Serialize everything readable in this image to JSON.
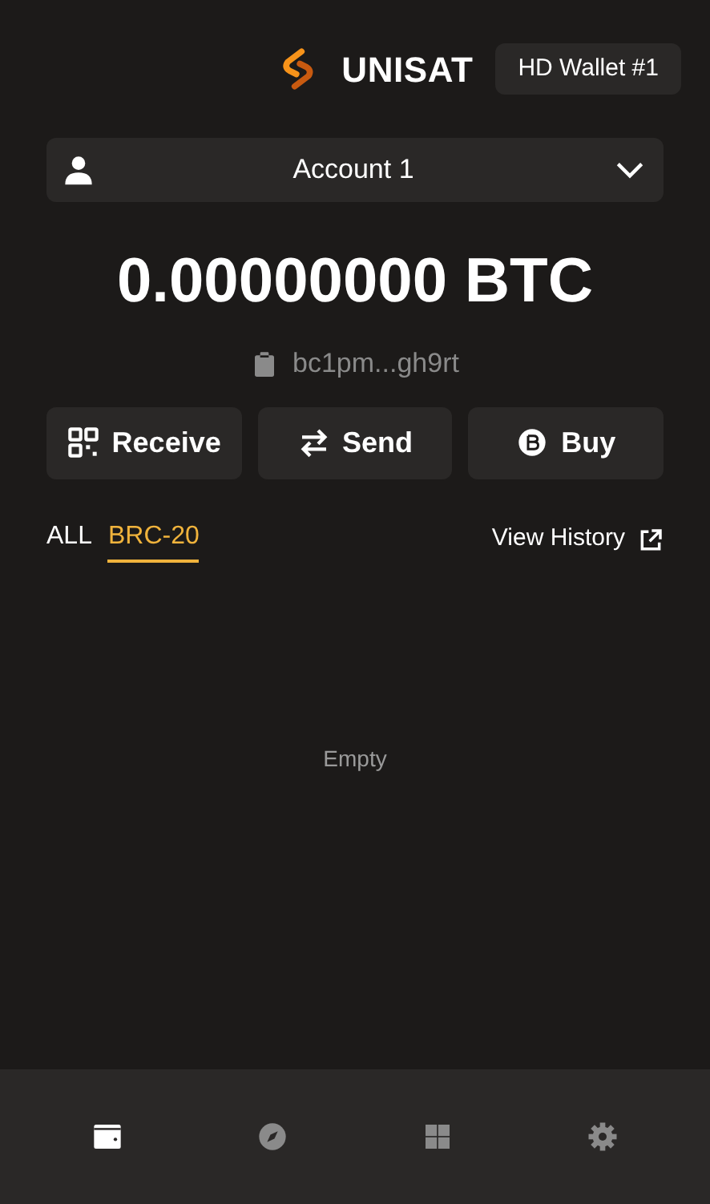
{
  "header": {
    "brand": "UNISAT",
    "wallet": "HD Wallet #1"
  },
  "account": {
    "name": "Account 1"
  },
  "balance": "0.00000000 BTC",
  "address": "bc1pm...gh9rt",
  "actions": [
    {
      "kind": "receive",
      "label": "Receive"
    },
    {
      "kind": "send",
      "label": "Send"
    },
    {
      "kind": "buy",
      "label": "Buy"
    }
  ],
  "tabs": [
    {
      "label": "ALL",
      "selected": false
    },
    {
      "label": "BRC-20",
      "selected": true
    }
  ],
  "history_link": "View History",
  "empty_text": "Empty",
  "nav": [
    {
      "kind": "wallet",
      "selected": true
    },
    {
      "kind": "discover",
      "selected": false
    },
    {
      "kind": "apps",
      "selected": false
    },
    {
      "kind": "settings",
      "selected": false
    }
  ]
}
